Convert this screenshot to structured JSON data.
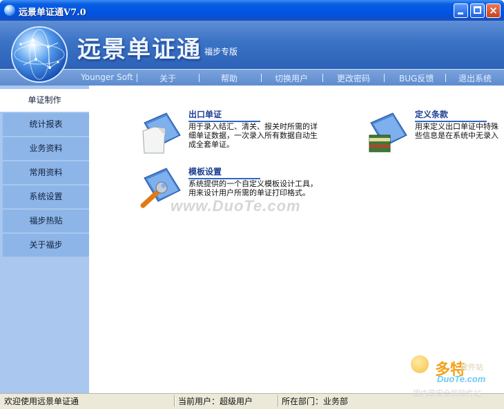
{
  "window": {
    "title": "远景单证通V7.0",
    "buttons": {
      "minimize": "minimize",
      "maximize": "maximize",
      "close": "×"
    }
  },
  "header": {
    "brand": "远景单证通",
    "edition": "福步专版"
  },
  "menu": {
    "items": [
      "Younger Soft",
      "关于",
      "帮助",
      "切换用户",
      "更改密码",
      "BUG反馈",
      "退出系统"
    ]
  },
  "sidebar": {
    "items": [
      "单证制作",
      "统计报表",
      "业务资料",
      "常用资料",
      "系统设置",
      "福步热贴",
      "关于福步"
    ],
    "active_index": 0
  },
  "features": [
    {
      "title": "出口单证",
      "desc": "用于录入结汇、清关、报关时所需的详\n细单证数据，一次录入所有数据自动生\n成全套单证。",
      "icon": "document-icon"
    },
    {
      "title": "定义条款",
      "desc": "用来定义出口单证中特殊\n些信息是在系统中无录入",
      "icon": "book-icon"
    },
    {
      "title": "模板设置",
      "desc": "系统提供的一个自定义模板设计工具，\n用来设计用户所需的单证打印格式。",
      "icon": "wrench-icon"
    }
  ],
  "watermark": "www.DuoTe.com",
  "statusbar": {
    "welcome": "欢迎使用远景单证通",
    "current_user_label": "当前用户：",
    "current_user": "超级用户",
    "department_label": "所在部门：",
    "department": "业务部"
  },
  "site_badge": {
    "name": "多特",
    "sub": "软件站",
    "url": "DuoTe.com",
    "tagline": "国内最安全的软件站"
  },
  "colors": {
    "titlebar": "#0054e3",
    "header": "#3a72c4",
    "sidebar": "#a9c7ef",
    "nav_item": "#8db5e8",
    "feature_title": "#1d3e92"
  }
}
